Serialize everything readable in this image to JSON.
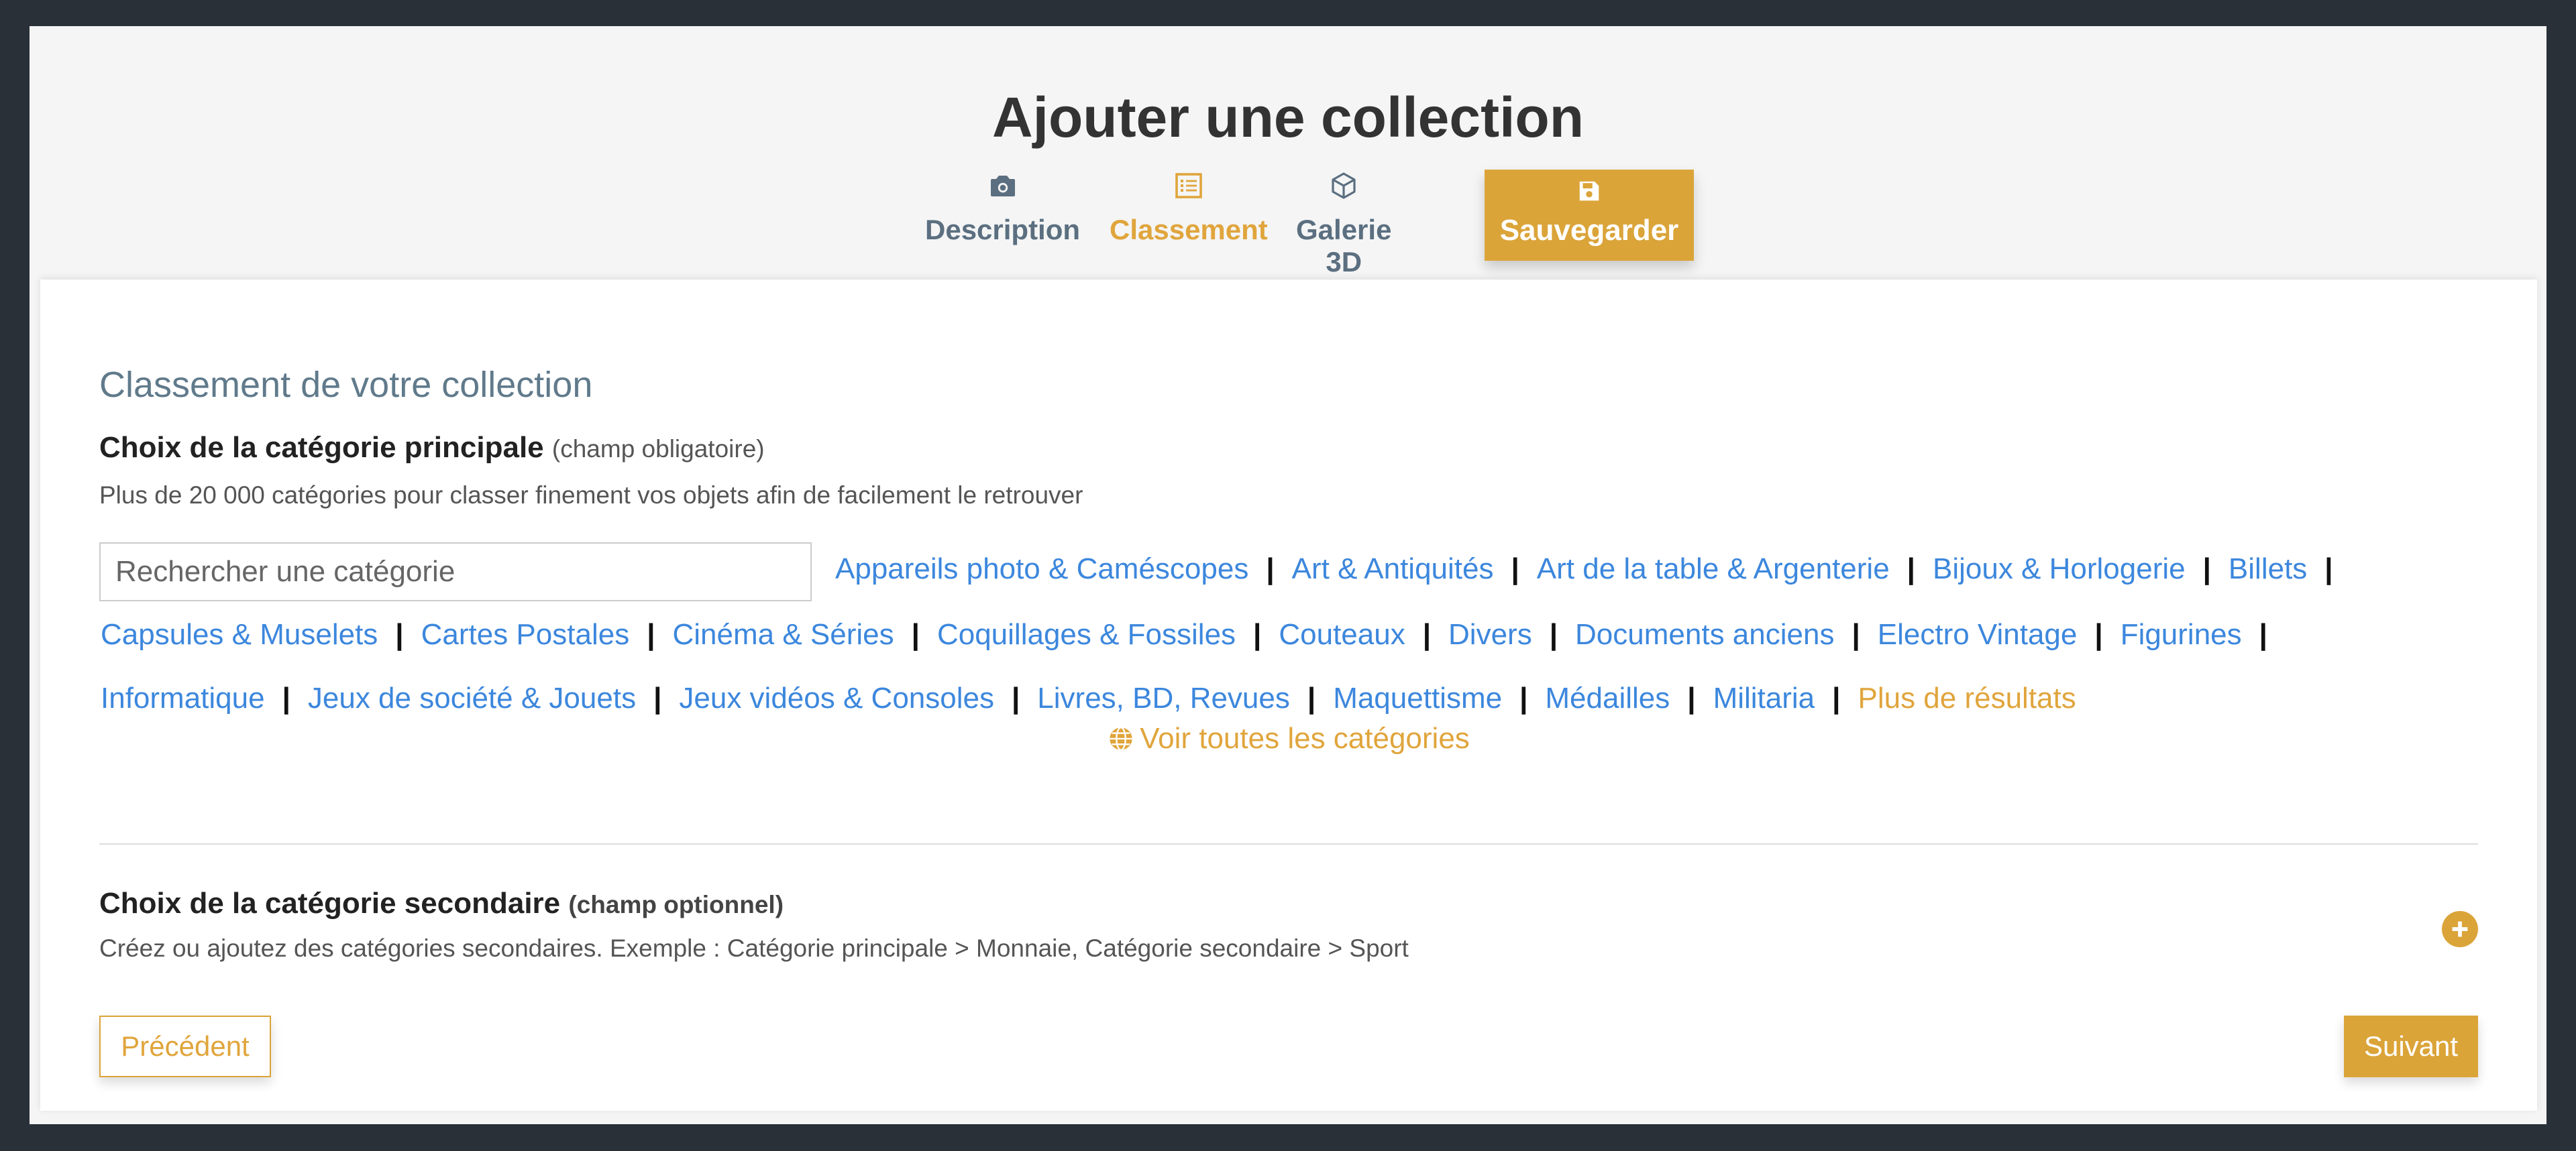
{
  "header": {
    "title": "Ajouter une collection",
    "tabs": [
      {
        "label": "Description",
        "icon": "camera-icon"
      },
      {
        "label": "Classement",
        "icon": "list-icon"
      },
      {
        "label": "Galerie 3D",
        "icon": "cube-icon"
      }
    ],
    "active_tab": "Classement",
    "save_label": "Sauvegarder",
    "save_icon": "floppy-disk-icon"
  },
  "colors": {
    "accent": "#dba439",
    "link": "#3c87dd",
    "background": "#293038"
  },
  "section_title": "Classement de votre collection",
  "main_category": {
    "label": "Choix de la catégorie principale",
    "hint": "(champ obligatoire)",
    "description": "Plus de 20 000 catégories pour classer finement vos objets afin de facilement le retrouver",
    "search_placeholder": "Rechercher une catégorie",
    "categories": [
      "Appareils photo & Caméscopes",
      "Art & Antiquités",
      "Art de la table & Argenterie",
      "Bijoux & Horlogerie",
      "Billets",
      "Capsules & Muselets",
      "Cartes Postales",
      "Cinéma & Séries",
      "Coquillages & Fossiles",
      "Couteaux",
      "Divers",
      "Documents anciens",
      "Electro Vintage",
      "Figurines",
      "Informatique",
      "Jeux de société & Jouets",
      "Jeux vidéos & Consoles",
      "Livres, BD, Revues",
      "Maquettisme",
      "Médailles",
      "Militaria"
    ],
    "separator": "|",
    "more_results": "Plus de résultats",
    "see_all": "Voir toutes les catégories",
    "see_all_icon": "globe-icon"
  },
  "secondary_category": {
    "label": "Choix de la catégorie secondaire",
    "hint": "(champ optionnel)",
    "description": "Créez ou ajoutez des catégories secondaires. Exemple : Catégorie principale > Monnaie, Catégorie secondaire > Sport",
    "add_icon": "plus-circle-icon"
  },
  "footer": {
    "prev_label": "Précédent",
    "next_label": "Suivant"
  }
}
